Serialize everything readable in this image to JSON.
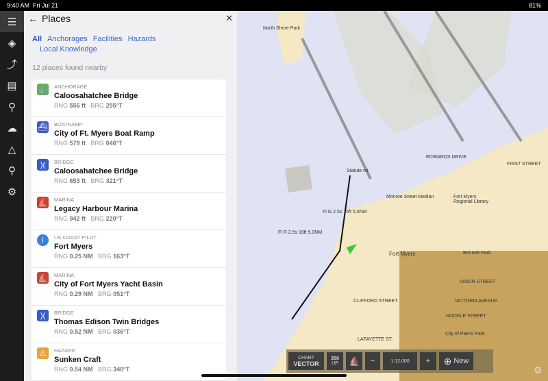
{
  "status": {
    "time": "9:40 AM",
    "date": "Fri Jul 21",
    "battery": "81%"
  },
  "rail": [
    "menu-icon",
    "layers-icon",
    "route-icon",
    "logbook-icon",
    "pin-icon",
    "weather-icon",
    "measure-icon",
    "search-icon",
    "settings-icon"
  ],
  "panel": {
    "title": "Places",
    "tabs": [
      "All",
      "Anchorages",
      "Facilities",
      "Hazards",
      "Local Knowledge"
    ],
    "count": "12 places found nearby",
    "items": [
      {
        "type": "Anchorage",
        "name": "Caloosahatchee Bridge",
        "rng": "556 ft",
        "brg": "255°T",
        "color": "#6aaa5a",
        "icon": "⚓"
      },
      {
        "type": "Boatramp",
        "name": "City of Ft. Myers Boat Ramp",
        "rng": "579 ft",
        "brg": "046°T",
        "color": "#3a5bc7",
        "icon": "⛴"
      },
      {
        "type": "Bridge",
        "name": "Caloosahatchee Bridge",
        "rng": "653 ft",
        "brg": "321°T",
        "color": "#3a5bc7",
        "icon": ")("
      },
      {
        "type": "Marina",
        "name": "Legacy Harbour Marina",
        "rng": "942 ft",
        "brg": "220°T",
        "color": "#c0453c",
        "icon": "⛵"
      },
      {
        "type": "US Coast Pilot",
        "name": "Fort Myers",
        "rng": "0.25 NM",
        "brg": "163°T",
        "color": "#3a7fd8",
        "icon": "i"
      },
      {
        "type": "Marina",
        "name": "City of Fort Myers Yacht Basin",
        "rng": "0.29 NM",
        "brg": "051°T",
        "color": "#c0453c",
        "icon": "⛵"
      },
      {
        "type": "Bridge",
        "name": "Thomas Edison Twin Bridges",
        "rng": "0.52 NM",
        "brg": "036°T",
        "color": "#3a5bc7",
        "icon": ")("
      },
      {
        "type": "Hazard",
        "name": "Sunken Craft",
        "rng": "0.54 NM",
        "brg": "340°T",
        "color": "#e8a33a",
        "icon": "⚠"
      }
    ],
    "rng_label": "RNG",
    "brg_label": "BRG"
  },
  "map": {
    "labels": [
      "North Shore Park",
      "Statute mi",
      "Monroe Street Median",
      "Fort Myers Regional Library",
      "Fort Myers",
      "Bennett Park",
      "UNION STREET",
      "VICTORIA AVENUE",
      "HOOKLE STREET",
      "City of Palms Park",
      "LAFAYETTE ST.",
      "FIRST STREET",
      "EDWARDS DRIVE",
      "CLIFFORD STREET",
      "Fl G 2.5s 16ft 5.0NM",
      "Fl R 2.5s 16ft 5.0NM"
    ]
  },
  "toolbar": {
    "chart": "CHART",
    "mode": "VECTOR",
    "heading": "356",
    "up": "UP",
    "zoom_out": "−",
    "scale": "1:12,000",
    "zoom_in": "+",
    "new": "New"
  }
}
